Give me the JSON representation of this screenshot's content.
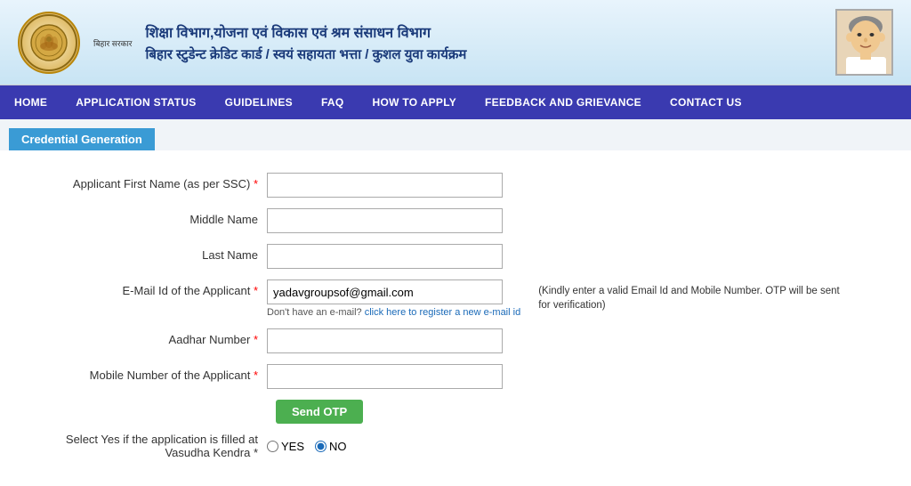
{
  "header": {
    "title_top": "शिक्षा विभाग,योजना एवं विकास एवं श्रम संसाधन विभाग",
    "title_bottom": "बिहार स्टुडेन्ट क्रेडिट कार्ड / स्वयं सहायता भत्ता / कुशल युवा कार्यक्रम",
    "logo_text": "बिहार सरकार"
  },
  "navbar": {
    "items": [
      {
        "label": "HOME",
        "id": "home"
      },
      {
        "label": "APPLICATION STATUS",
        "id": "app-status"
      },
      {
        "label": "GUIDELINES",
        "id": "guidelines"
      },
      {
        "label": "FAQ",
        "id": "faq"
      },
      {
        "label": "HOW TO APPLY",
        "id": "how-to-apply"
      },
      {
        "label": "FEEDBACK AND GRIEVANCE",
        "id": "feedback"
      },
      {
        "label": "CONTACT US",
        "id": "contact"
      }
    ]
  },
  "credential_badge": "Credential Generation",
  "form": {
    "fields": [
      {
        "label": "Applicant First Name (as per SSC)",
        "required": true,
        "id": "first-name",
        "value": "",
        "placeholder": ""
      },
      {
        "label": "Middle Name",
        "required": false,
        "id": "middle-name",
        "value": "",
        "placeholder": ""
      },
      {
        "label": "Last Name",
        "required": false,
        "id": "last-name",
        "value": "",
        "placeholder": ""
      },
      {
        "label": "E-Mail Id of the Applicant",
        "required": true,
        "id": "email",
        "value": "yadavgroupsof@gmail.com",
        "placeholder": ""
      },
      {
        "label": "Aadhar Number",
        "required": true,
        "id": "aadhar",
        "value": "",
        "placeholder": ""
      },
      {
        "label": "Mobile Number of the Applicant",
        "required": true,
        "id": "mobile",
        "value": "",
        "placeholder": ""
      }
    ],
    "email_link_text": "click here to register a new e-mail id",
    "email_note_prefix": "Don't have an e-mail?",
    "otp_hint": "(Kindly enter a valid Email Id and Mobile Number. OTP will be sent for verification)",
    "send_otp_label": "Send OTP",
    "vasudha_label": "Select Yes if the application is filled at Vasudha Kendra",
    "vasudha_required": true,
    "radio_yes": "YES",
    "radio_no": "NO",
    "radio_selected": "NO"
  }
}
